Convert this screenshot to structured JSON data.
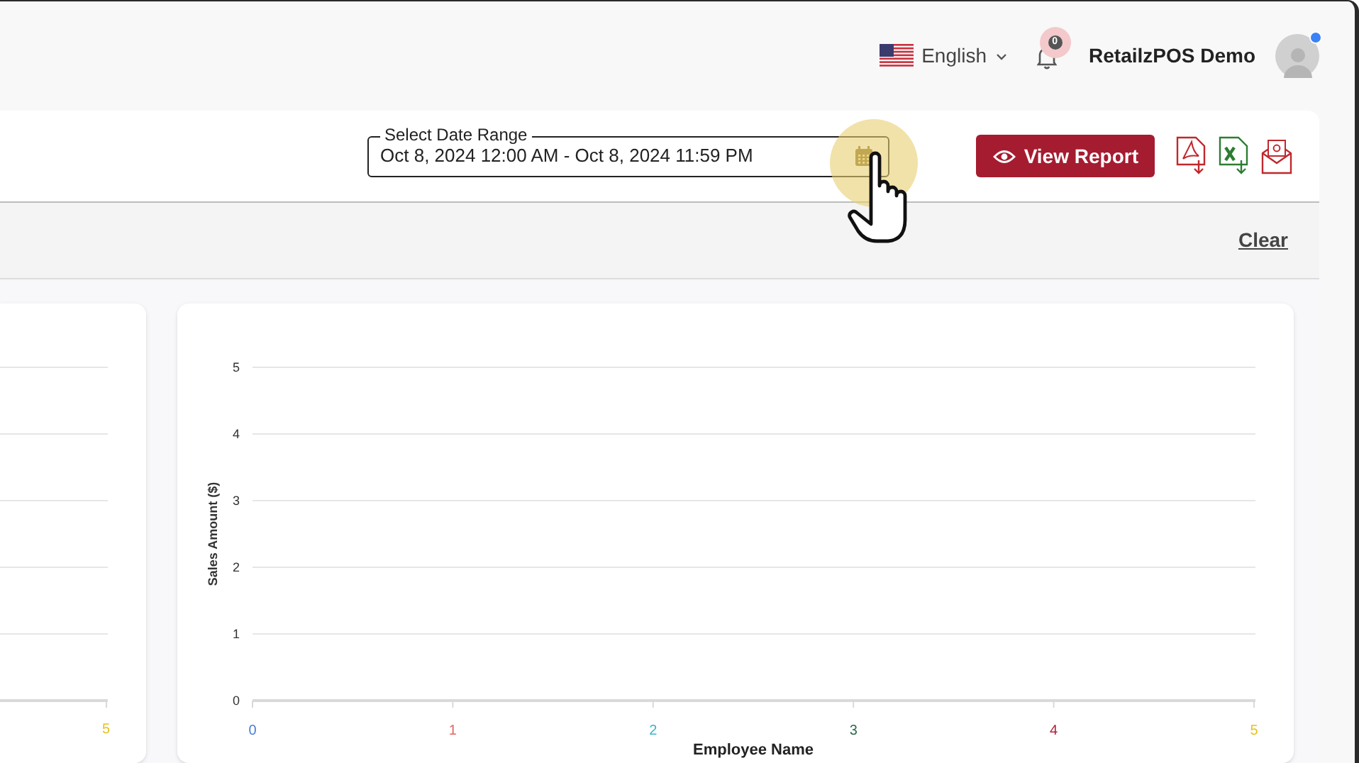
{
  "header": {
    "language": "English",
    "notification_count": "0",
    "user_name": "RetailzPOS Demo",
    "user_online": true
  },
  "toolbar": {
    "date_range": {
      "label": "Select Date Range",
      "value": "Oct 8, 2024 12:00 AM - Oct 8, 2024 11:59 PM"
    },
    "view_report": "View Report"
  },
  "filter_bar": {
    "clear": "Clear"
  },
  "charts": [
    {
      "x_tick_label": "5"
    },
    {
      "chart_data": {
        "type": "bar",
        "xlabel": "Employee Name",
        "ylabel": "Sales Amount ($)",
        "categories": [
          "0",
          "1",
          "2",
          "3",
          "4",
          "5"
        ],
        "values": [
          null,
          null,
          null,
          null,
          null,
          null
        ],
        "ylim": [
          0,
          5
        ],
        "grid": true,
        "yticks": [
          0,
          1,
          2,
          3,
          4,
          5
        ]
      }
    }
  ]
}
